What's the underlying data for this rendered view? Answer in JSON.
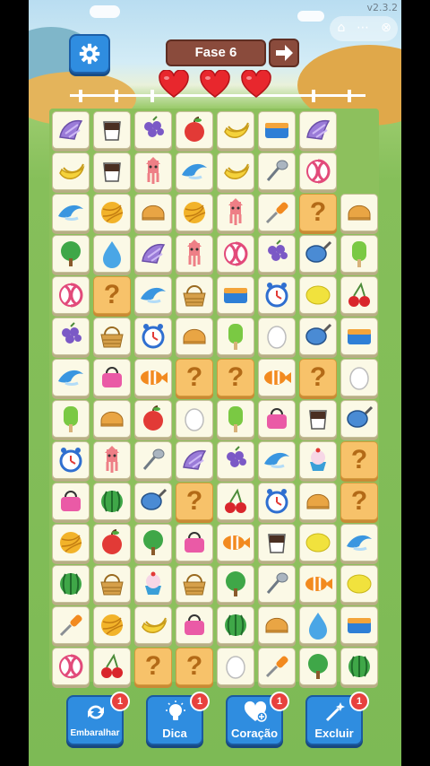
{
  "version": "v2.3.2",
  "level_label": "Fase 6",
  "hearts": 3,
  "colors": {
    "accent": "#2f8de0",
    "badge": "#e8413e",
    "tile": "#fbf9e6",
    "hidden_tile": "#f7c26a",
    "level_bg": "#8a4b3c"
  },
  "hidden_symbol": "?",
  "board": [
    [
      "shell",
      "coffee",
      "grapes",
      "apple",
      "banana",
      "lunchbox",
      "shell"
    ],
    [
      "banana",
      "coffee",
      "squid",
      "dolphin",
      "banana",
      "spoon",
      "candy"
    ],
    [
      "dolphin",
      "yarn",
      "bread",
      "yarn",
      "squid",
      "screwdriver",
      "?",
      "bread"
    ],
    [
      "tree",
      "water",
      "shell",
      "squid",
      "candy",
      "grapes",
      "pan",
      "popsicle"
    ],
    [
      "candy",
      "?",
      "dolphin",
      "basket",
      "lunchbox",
      "clock",
      "lemon",
      "cherry"
    ],
    [
      "grapes",
      "basket",
      "clock",
      "bread",
      "popsicle",
      "egg",
      "pan",
      "lunchbox"
    ],
    [
      "dolphin",
      "bag",
      "fish",
      "?",
      "?",
      "fish",
      "?",
      "egg"
    ],
    [
      "popsicle",
      "bread",
      "apple",
      "egg",
      "popsicle",
      "bag",
      "coffee",
      "pan"
    ],
    [
      "clock",
      "squid",
      "spoon",
      "shell",
      "grapes",
      "dolphin",
      "cupcake",
      "?"
    ],
    [
      "bag",
      "melon",
      "pan",
      "?",
      "cherry",
      "clock",
      "bread",
      "?"
    ],
    [
      "yarn",
      "apple",
      "tree",
      "bag",
      "fish",
      "coffee",
      "lemon",
      "dolphin"
    ],
    [
      "melon",
      "basket",
      "cupcake",
      "basket",
      "tree",
      "spoon",
      "fish",
      "lemon"
    ],
    [
      "screwdriver",
      "yarn",
      "banana",
      "bag",
      "melon",
      "bread",
      "water",
      "lunchbox"
    ],
    [
      "candy",
      "cherry",
      "?",
      "?",
      "egg",
      "screwdriver",
      "tree",
      "melon"
    ]
  ],
  "buttons": [
    {
      "label": "Embaralhar",
      "badge": "1",
      "icon": "shuffle-icon"
    },
    {
      "label": "Dica",
      "badge": "1",
      "icon": "lightbulb-icon"
    },
    {
      "label": "Coração",
      "badge": "1",
      "icon": "heart-plus-icon"
    },
    {
      "label": "Excluir",
      "badge": "1",
      "icon": "magic-wand-icon"
    }
  ]
}
